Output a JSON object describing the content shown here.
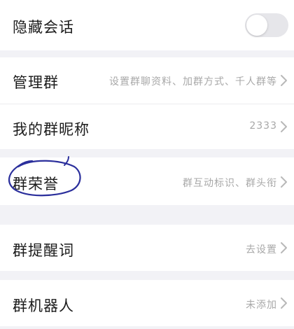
{
  "rows": {
    "hide_chat": {
      "label": "隐藏会话",
      "toggle_on": false
    },
    "manage_group": {
      "label": "管理群",
      "value": "设置群聊资料、加群方式、千人群等"
    },
    "my_nickname": {
      "label": "我的群昵称",
      "value": "2333"
    },
    "group_honor": {
      "label": "群荣誉",
      "value": "群互动标识、群头衔"
    },
    "group_reminder": {
      "label": "群提醒词",
      "value": "去设置"
    },
    "group_robot": {
      "label": "群机器人",
      "value": "未添加"
    }
  },
  "colors": {
    "page_background": "#f2f2f6",
    "row_background": "#ffffff",
    "label_text": "#1c1c1c",
    "value_text": "#a8a8a8",
    "annotation_ink": "#2b2f9c"
  },
  "icons": {
    "row_arrow": "chevron-right-icon"
  }
}
